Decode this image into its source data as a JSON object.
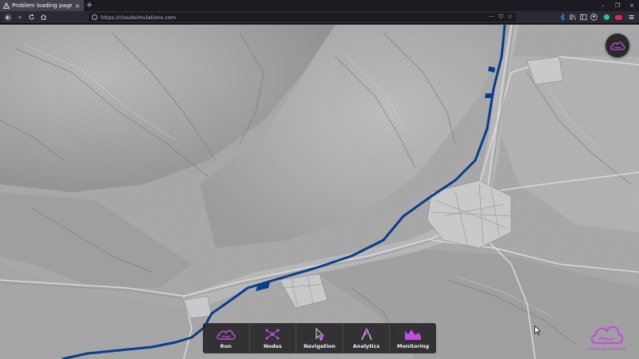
{
  "browser": {
    "tab_title": "Problem loading page",
    "tab_close": "×",
    "new_tab": "+",
    "window_controls": [
      "–",
      "❐",
      "×"
    ],
    "url": "https://cloudsimulations.com",
    "url_actions": [
      "···",
      "⛉",
      "☆"
    ]
  },
  "map": {
    "style": "grayscale hillshade terrain",
    "river_color": "#0a3c8c"
  },
  "toolbar": {
    "accent": "#c04fe0",
    "items": [
      {
        "label": "Run",
        "icon": "cloud-run-icon"
      },
      {
        "label": "Nodes",
        "icon": "nodes-icon"
      },
      {
        "label": "Navigation",
        "icon": "navigation-icon"
      },
      {
        "label": "Analytics",
        "icon": "analytics-icon"
      },
      {
        "label": "Monitoring",
        "icon": "monitoring-icon"
      }
    ]
  },
  "brand": {
    "name": "cloud simulations",
    "logo_icon": "cloud-logo-icon"
  }
}
